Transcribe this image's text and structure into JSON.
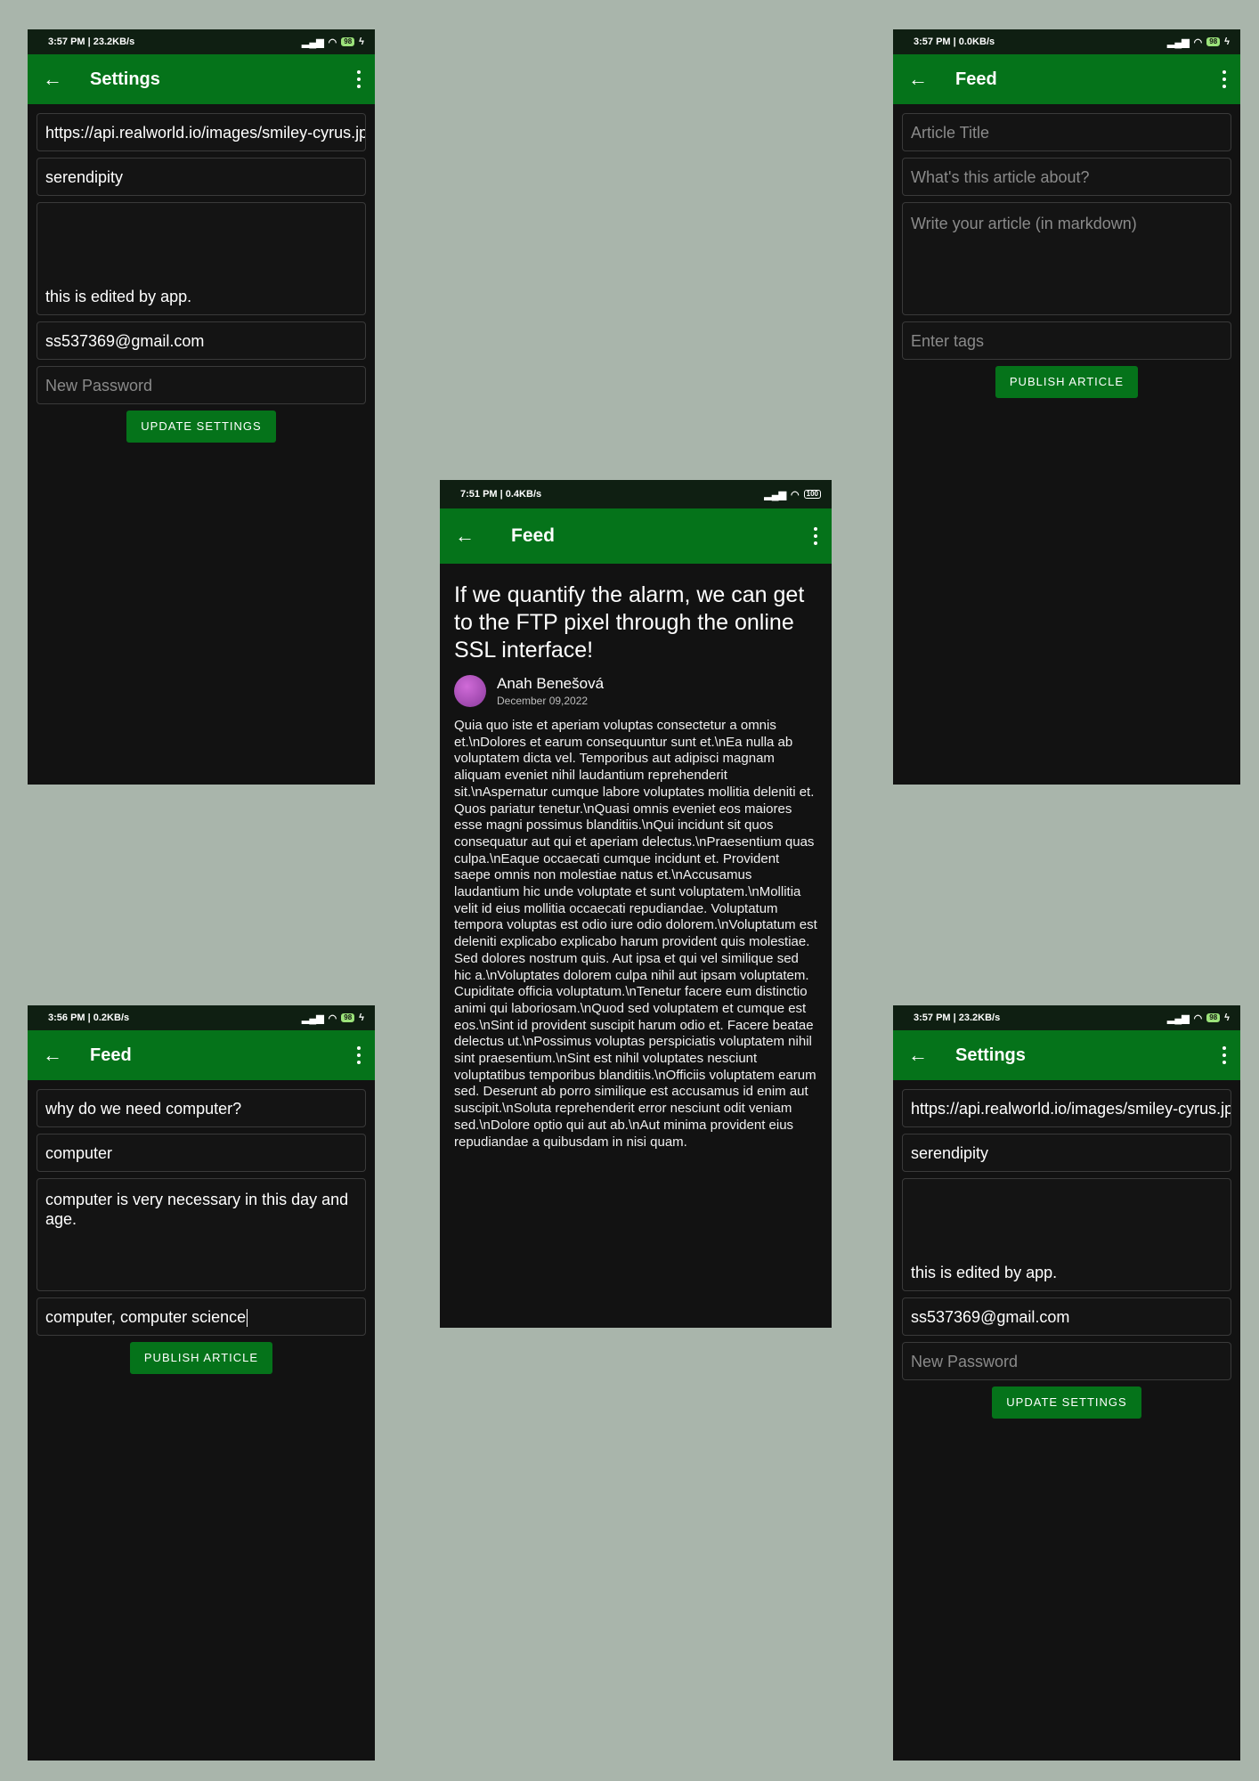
{
  "screens": {
    "settings_top": {
      "status": {
        "time": "3:57 PM | 23.2KB/s",
        "battery": "98"
      },
      "appbar_title": "Settings",
      "image_url": "https://api.realworld.io/images/smiley-cyrus.jpeg",
      "username": "serendipity",
      "bio": "this is edited by app.",
      "email": "ss537369@gmail.com",
      "password_placeholder": "New Password",
      "button": "UPDATE SETTINGS"
    },
    "new_article": {
      "status": {
        "time": "3:57 PM | 0.0KB/s",
        "battery": "98"
      },
      "appbar_title": "Feed",
      "title_placeholder": "Article Title",
      "about_placeholder": "What's this article about?",
      "body_placeholder": "Write your article (in markdown)",
      "tags_placeholder": "Enter tags",
      "button": "PUBLISH ARTICLE"
    },
    "article_detail": {
      "status": {
        "time": "7:51 PM | 0.4KB/s",
        "battery": "100"
      },
      "appbar_title": "Feed",
      "title": "If we quantify the alarm, we can get to the FTP pixel through the online SSL interface!",
      "author": "Anah Benešová",
      "date": "December 09,2022",
      "body": "Quia quo iste et aperiam voluptas consectetur a omnis et.\\nDolores et earum consequuntur sunt et.\\nEa nulla ab voluptatem dicta vel. Temporibus aut adipisci magnam aliquam eveniet nihil laudantium reprehenderit sit.\\nAspernatur cumque labore voluptates mollitia deleniti et. Quos pariatur tenetur.\\nQuasi omnis eveniet eos maiores esse magni possimus blanditiis.\\nQui incidunt sit quos consequatur aut qui et aperiam delectus.\\nPraesentium quas culpa.\\nEaque occaecati cumque incidunt et. Provident saepe omnis non molestiae natus et.\\nAccusamus laudantium hic unde voluptate et sunt voluptatem.\\nMollitia velit id eius mollitia occaecati repudiandae. Voluptatum tempora voluptas est odio iure odio dolorem.\\nVoluptatum est deleniti explicabo explicabo harum provident quis molestiae. Sed dolores nostrum quis. Aut ipsa et qui vel similique sed hic a.\\nVoluptates dolorem culpa nihil aut ipsam voluptatem. Cupiditate officia voluptatum.\\nTenetur facere eum distinctio animi qui laboriosam.\\nQuod sed voluptatem et cumque est eos.\\nSint id provident suscipit harum odio et. Facere beatae delectus ut.\\nPossimus voluptas perspiciatis voluptatem nihil sint praesentium.\\nSint est nihil voluptates nesciunt voluptatibus temporibus blanditiis.\\nOfficiis voluptatem earum sed. Deserunt ab porro similique est accusamus id enim aut suscipit.\\nSoluta reprehenderit error nesciunt odit veniam sed.\\nDolore optio qui aut ab.\\nAut minima provident eius repudiandae a quibusdam in nisi quam."
    },
    "filled_article": {
      "status": {
        "time": "3:56 PM | 0.2KB/s",
        "battery": "98"
      },
      "appbar_title": "Feed",
      "title": "why do we need computer?",
      "about": "computer",
      "body": "computer is very necessary in this day and age.",
      "tags": "computer, computer science",
      "button": "PUBLISH ARTICLE"
    },
    "settings_bottom": {
      "status": {
        "time": "3:57 PM | 23.2KB/s",
        "battery": "98"
      },
      "appbar_title": "Settings",
      "image_url": "https://api.realworld.io/images/smiley-cyrus.jpeg",
      "username": "serendipity",
      "bio": "this is edited by app.",
      "email": "ss537369@gmail.com",
      "password_placeholder": "New Password",
      "button": "UPDATE SETTINGS"
    }
  },
  "icons": {
    "back": "arrow-left",
    "menu": "more-vert",
    "signal": "signal",
    "wifi": "wifi",
    "battery": "battery",
    "alarm": "alarm"
  }
}
